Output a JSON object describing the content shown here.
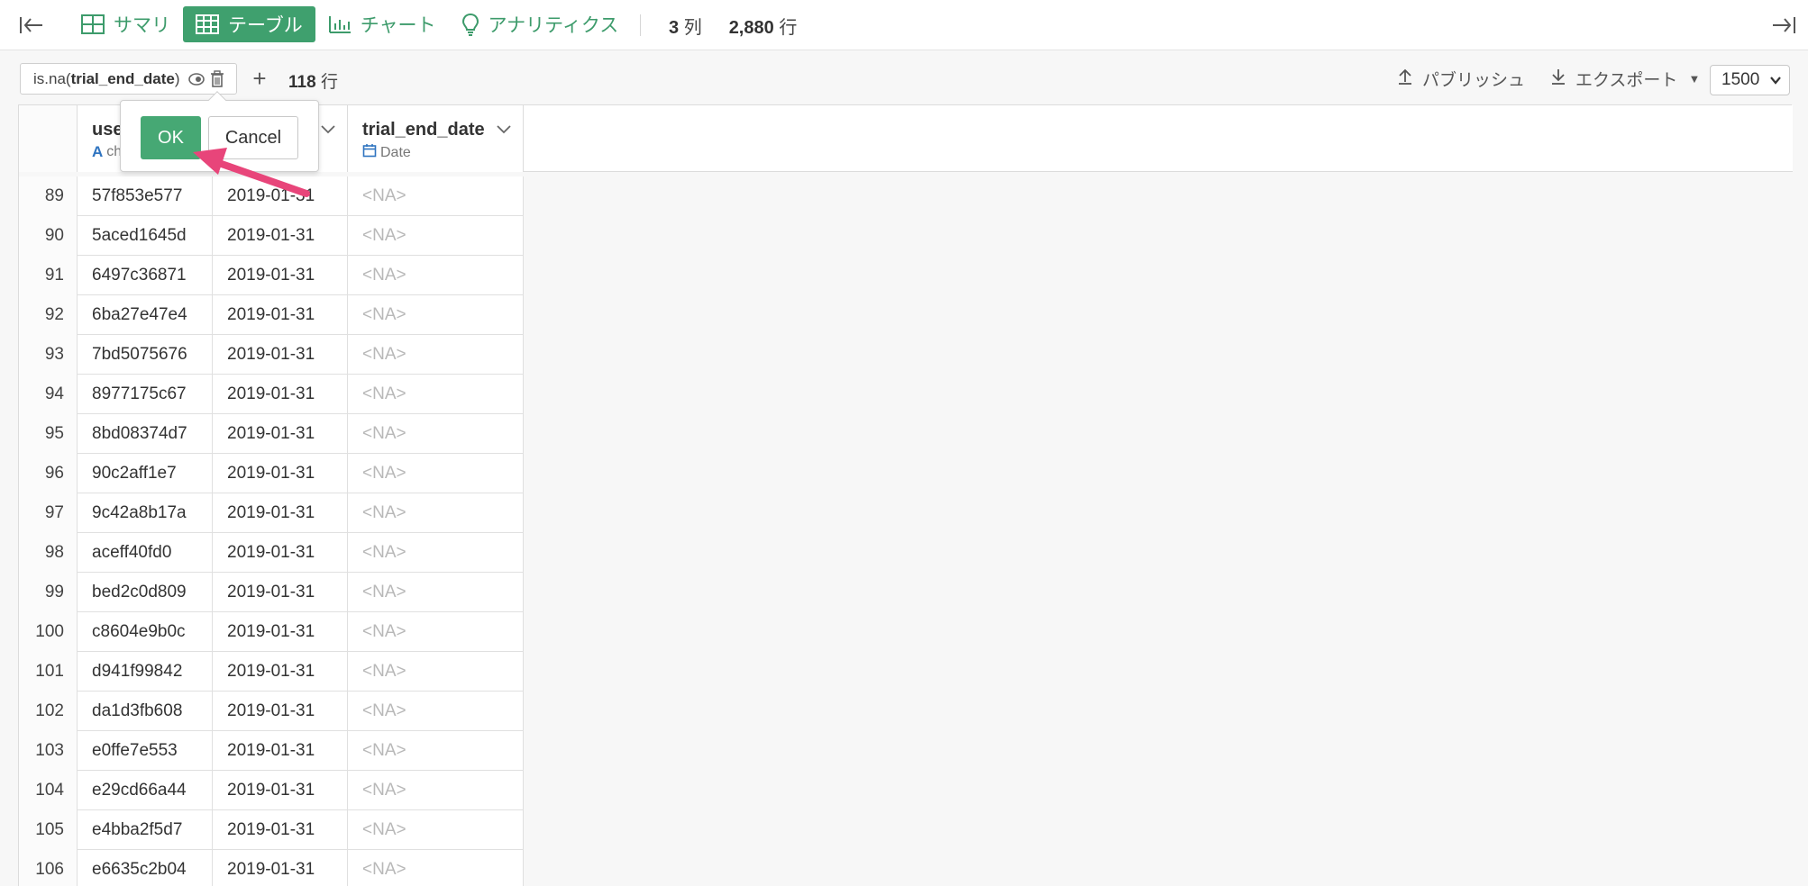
{
  "toolbar": {
    "tabs": [
      {
        "label": "サマリ",
        "icon": "summary-grid-icon",
        "active": false
      },
      {
        "label": "テーブル",
        "icon": "table-icon",
        "active": true
      },
      {
        "label": "チャート",
        "icon": "bar-chart-icon",
        "active": false
      },
      {
        "label": "アナリティクス",
        "icon": "lightbulb-icon",
        "active": false
      }
    ],
    "col_count": "3",
    "col_unit": "列",
    "row_count": "2,880",
    "row_unit": "行"
  },
  "filter": {
    "prefix": "is.na(",
    "column": "trial_end_date",
    "suffix": ")",
    "result_rows": "118",
    "result_unit": "行"
  },
  "actions": {
    "publish_label": "パブリッシュ",
    "export_label": "エクスポート",
    "rows_per_page": "1500"
  },
  "popover": {
    "ok_label": "OK",
    "cancel_label": "Cancel"
  },
  "columns": [
    {
      "name": "use",
      "type": "ch"
    },
    {
      "name": "",
      "type": ""
    },
    {
      "name": "trial_end_date",
      "type": "Date"
    }
  ],
  "rows": [
    {
      "idx": "89",
      "user": "57f853e577",
      "date": "2019-01-31",
      "end": "<NA>"
    },
    {
      "idx": "90",
      "user": "5aced1645d",
      "date": "2019-01-31",
      "end": "<NA>"
    },
    {
      "idx": "91",
      "user": "6497c36871",
      "date": "2019-01-31",
      "end": "<NA>"
    },
    {
      "idx": "92",
      "user": "6ba27e47e4",
      "date": "2019-01-31",
      "end": "<NA>"
    },
    {
      "idx": "93",
      "user": "7bd5075676",
      "date": "2019-01-31",
      "end": "<NA>"
    },
    {
      "idx": "94",
      "user": "8977175c67",
      "date": "2019-01-31",
      "end": "<NA>"
    },
    {
      "idx": "95",
      "user": "8bd08374d7",
      "date": "2019-01-31",
      "end": "<NA>"
    },
    {
      "idx": "96",
      "user": "90c2aff1e7",
      "date": "2019-01-31",
      "end": "<NA>"
    },
    {
      "idx": "97",
      "user": "9c42a8b17a",
      "date": "2019-01-31",
      "end": "<NA>"
    },
    {
      "idx": "98",
      "user": "aceff40fd0",
      "date": "2019-01-31",
      "end": "<NA>"
    },
    {
      "idx": "99",
      "user": "bed2c0d809",
      "date": "2019-01-31",
      "end": "<NA>"
    },
    {
      "idx": "100",
      "user": "c8604e9b0c",
      "date": "2019-01-31",
      "end": "<NA>"
    },
    {
      "idx": "101",
      "user": "d941f99842",
      "date": "2019-01-31",
      "end": "<NA>"
    },
    {
      "idx": "102",
      "user": "da1d3fb608",
      "date": "2019-01-31",
      "end": "<NA>"
    },
    {
      "idx": "103",
      "user": "e0ffe7e553",
      "date": "2019-01-31",
      "end": "<NA>"
    },
    {
      "idx": "104",
      "user": "e29cd66a44",
      "date": "2019-01-31",
      "end": "<NA>"
    },
    {
      "idx": "105",
      "user": "e4bba2f5d7",
      "date": "2019-01-31",
      "end": "<NA>"
    },
    {
      "idx": "106",
      "user": "e6635c2b04",
      "date": "2019-01-31",
      "end": "<NA>"
    }
  ],
  "colors": {
    "accent": "#3fa06e",
    "annotation_arrow": "#e8457a",
    "na_text": "#b8b8b8"
  }
}
